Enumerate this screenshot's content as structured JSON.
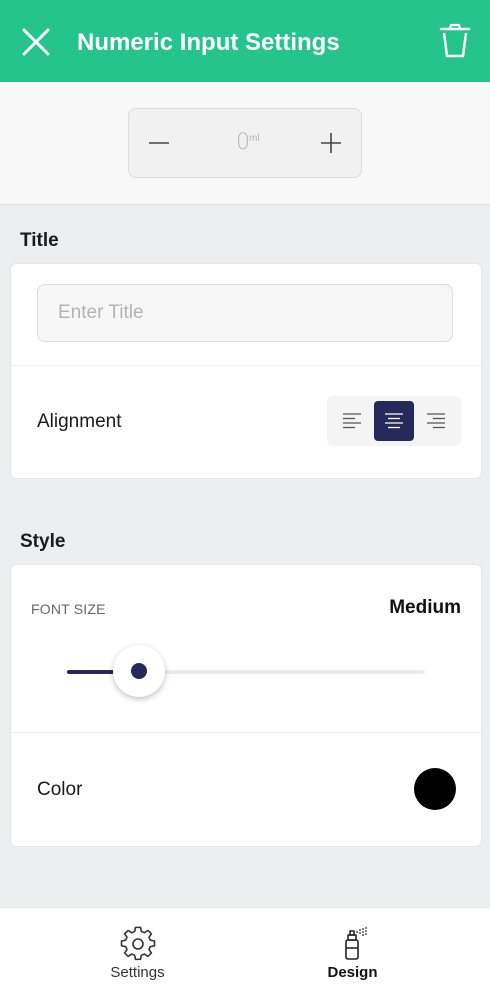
{
  "header": {
    "title": "Numeric Input Settings",
    "bg_color": "#25c48c",
    "close_icon": "close-icon",
    "delete_icon": "trash-icon"
  },
  "preview": {
    "value": "0",
    "unit": "ml",
    "decrement_icon": "minus-icon",
    "increment_icon": "plus-icon"
  },
  "title_section": {
    "heading": "Title",
    "input_value": "",
    "input_placeholder": "Enter Title",
    "alignment_label": "Alignment",
    "alignment_options": [
      "left",
      "center",
      "right"
    ],
    "alignment_selected": "center"
  },
  "style_section": {
    "heading": "Style",
    "font_size_label": "FONT SIZE",
    "font_size_value": "Medium",
    "font_size_slider_fraction": 0.2,
    "color_label": "Color",
    "color_value": "#000000"
  },
  "bottom_nav": {
    "items": [
      {
        "label": "Settings",
        "icon": "gear-icon",
        "active": false
      },
      {
        "label": "Design",
        "icon": "paint-spray-icon",
        "active": true
      }
    ]
  },
  "colors": {
    "accent": "#25c48c",
    "selected": "#262a5a"
  }
}
